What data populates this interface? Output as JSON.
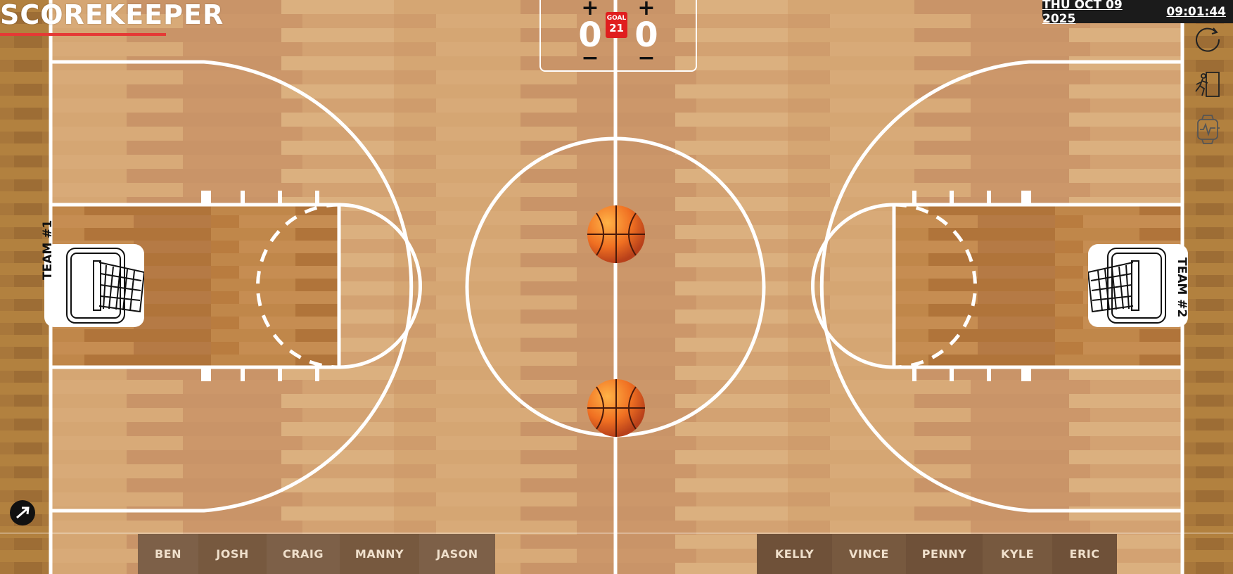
{
  "app": {
    "title": "SCOREKEEPER"
  },
  "header": {
    "date": "THU OCT 09 2025",
    "time": "09:01:44"
  },
  "scoreboard": {
    "team1_score": "0",
    "team2_score": "0",
    "goal_label": "GOAL",
    "goal_value": "21",
    "plus": "+",
    "minus": "−"
  },
  "teams": {
    "team1_label": "TEAM #1",
    "team2_label": "TEAM #2"
  },
  "side_icons": [
    "reset-icon",
    "exit-runner-icon",
    "smartwatch-icon"
  ],
  "roster": {
    "team1": [
      "BEN",
      "JOSH",
      "CRAIG",
      "MANNY",
      "JASON"
    ],
    "team2": [
      "KELLY",
      "VINCE",
      "PENNY",
      "KYLE",
      "ERIC"
    ]
  },
  "colors": {
    "accent": "#e53935",
    "goal_badge": "#e01e1e",
    "court_line": "#ffffff",
    "roster_bg": "#7a5c44"
  }
}
